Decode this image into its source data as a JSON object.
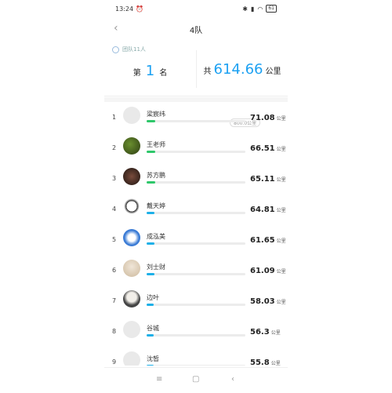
{
  "status": {
    "time": "13:24",
    "battery": "61"
  },
  "header": {
    "title": "4队"
  },
  "team": {
    "member_count": "团队11人",
    "rank_prefix": "第",
    "rank": "1",
    "rank_suffix": "名",
    "total_prefix": "共",
    "total": "614.66",
    "total_unit": "公里",
    "daily": "800.0公里"
  },
  "members": [
    {
      "rank": "1",
      "name": "梁宸纬",
      "value": "71.08",
      "unit": "公里",
      "progress": 0.09,
      "color": "#2ec76a",
      "avatar": "default"
    },
    {
      "rank": "2",
      "name": "王老师",
      "value": "66.51",
      "unit": "公里",
      "progress": 0.09,
      "color": "#2ec76a",
      "avatar": "plant"
    },
    {
      "rank": "3",
      "name": "苏方鹏",
      "value": "65.11",
      "unit": "公里",
      "progress": 0.09,
      "color": "#2ec76a",
      "avatar": "dark"
    },
    {
      "rank": "4",
      "name": "戴天婷",
      "value": "64.81",
      "unit": "公里",
      "progress": 0.08,
      "color": "#1db0e8",
      "avatar": "comic"
    },
    {
      "rank": "5",
      "name": "成泓美",
      "value": "61.65",
      "unit": "公里",
      "progress": 0.08,
      "color": "#1db0e8",
      "avatar": "cartoon"
    },
    {
      "rank": "6",
      "name": "刘士财",
      "value": "61.09",
      "unit": "公里",
      "progress": 0.08,
      "color": "#1db0e8",
      "avatar": "light"
    },
    {
      "rank": "7",
      "name": "边叶",
      "value": "58.03",
      "unit": "公里",
      "progress": 0.07,
      "color": "#1db0e8",
      "avatar": "person"
    },
    {
      "rank": "8",
      "name": "谷城",
      "value": "56.3",
      "unit": "公里",
      "progress": 0.07,
      "color": "#1db0e8",
      "avatar": "default"
    },
    {
      "rank": "9",
      "name": "沈皙",
      "value": "55.8",
      "unit": "公里",
      "progress": 0.07,
      "color": "#1db0e8",
      "avatar": "default"
    }
  ]
}
